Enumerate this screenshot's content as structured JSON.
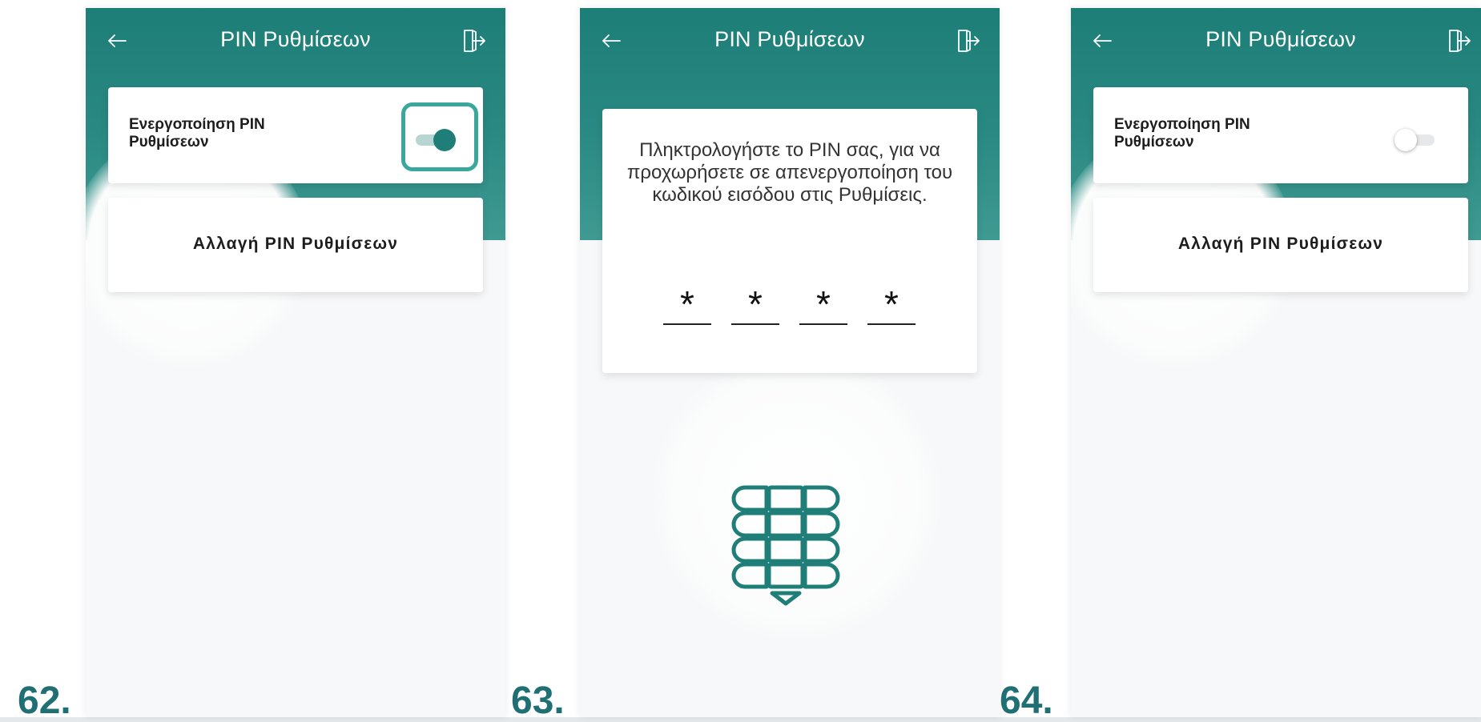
{
  "screens": [
    {
      "step": "62.",
      "title": "PIN Ρυθμίσεων",
      "toggle_label": "Ενεργοποίηση PIN Ρυθμίσεων",
      "toggle_state": "on",
      "change_label": "Αλλαγή PIN Ρυθμίσεων"
    },
    {
      "step": "63.",
      "title": "PIN Ρυθμίσεων",
      "pin_message": "Πληκτρολογήστε το PIN σας, για να προχωρήσετε σε απενεργοποίηση του κωδικού εισόδου στις Ρυθμίσεις.",
      "pin_digits": [
        "*",
        "*",
        "*",
        "*"
      ]
    },
    {
      "step": "64.",
      "title": "PIN Ρυθμίσεων",
      "toggle_label": "Ενεργοποίηση PIN Ρυθμίσεων",
      "toggle_state": "off",
      "change_label": "Αλλαγή PIN Ρυθμίσεων"
    }
  ],
  "colors": {
    "header_teal": "#1d7d77",
    "accent_teal": "#1f7f78",
    "highlight": "#3aa79c",
    "step_number": "#206f75"
  },
  "icons": [
    "back-arrow-icon",
    "logout-icon",
    "keypad-icon"
  ]
}
